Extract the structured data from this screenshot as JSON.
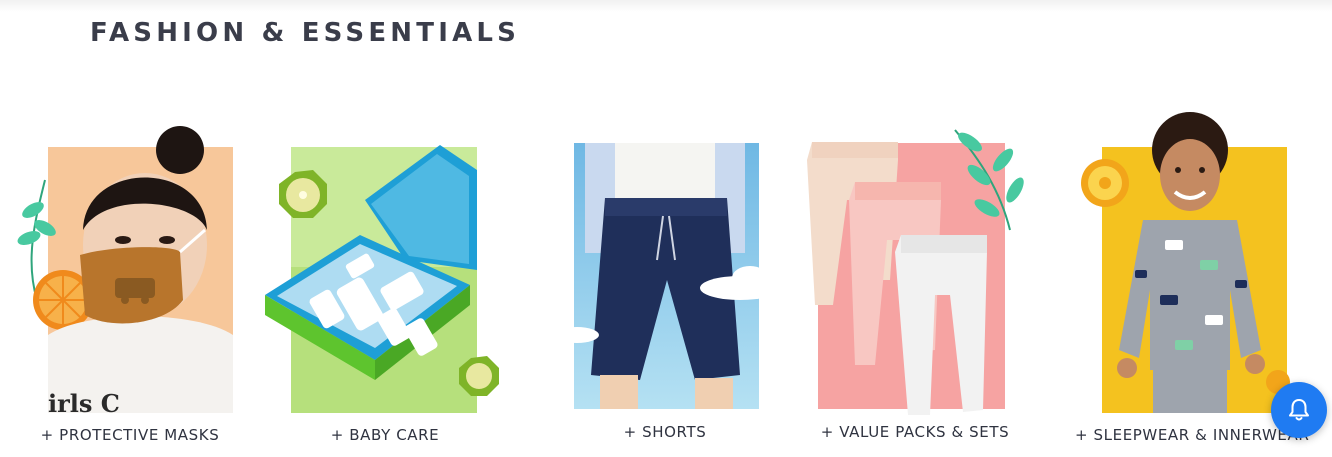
{
  "section": {
    "title": "FASHION & ESSENTIALS"
  },
  "categories": [
    {
      "label": "+ PROTECTIVE MASKS",
      "image_text": "irls C",
      "bg": "#f7c79a",
      "icon": "mask-girl-image"
    },
    {
      "label": "+ BABY CARE",
      "bg": "#b6e07c",
      "icon": "baby-care-kit-image"
    },
    {
      "label": "+ SHORTS",
      "bg": "#8fcdea",
      "icon": "shorts-image"
    },
    {
      "label": "+ VALUE PACKS & SETS",
      "bg": "#f6a3a2",
      "icon": "leggings-pack-image"
    },
    {
      "label": "+ SLEEPWEAR & INNERWEAR",
      "bg": "#f4c21f",
      "icon": "pajama-boy-image"
    }
  ],
  "colors": {
    "accent": "#1f7bf2",
    "title": "#3a3d4a",
    "label": "#2f3340"
  },
  "notification": {
    "icon": "bell-icon"
  }
}
